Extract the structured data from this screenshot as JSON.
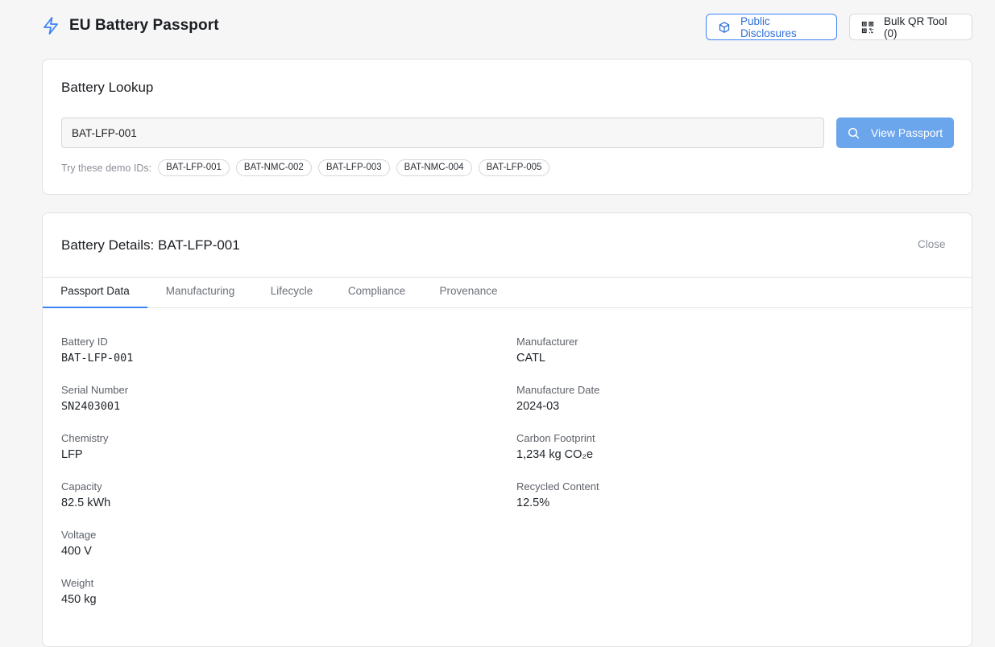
{
  "app": {
    "title": "EU Battery Passport",
    "accent_color": "#3b82f6",
    "icon": "lightning-bolt-icon"
  },
  "header": {
    "public_disclosures_label": "Public Disclosures",
    "public_disclosures_icon": "cube-icon",
    "bulk_qr_label": "Bulk QR Tool (0)",
    "bulk_qr_icon": "qr-code-icon"
  },
  "lookup": {
    "title": "Battery Lookup",
    "input_value": "BAT-LFP-001",
    "view_button_label": "View Passport",
    "view_button_icon": "search-icon",
    "demo_label": "Try these demo IDs:",
    "demo_ids": [
      "BAT-LFP-001",
      "BAT-NMC-002",
      "BAT-LFP-003",
      "BAT-NMC-004",
      "BAT-LFP-005"
    ]
  },
  "details": {
    "title": "Battery Details: BAT-LFP-001",
    "close_label": "Close",
    "tabs": [
      "Passport Data",
      "Manufacturing",
      "Lifecycle",
      "Compliance",
      "Provenance"
    ],
    "active_tab": "Passport Data",
    "left_fields": [
      {
        "label": "Battery ID",
        "value": "BAT-LFP-001"
      },
      {
        "label": "Serial Number",
        "value": "SN2403001"
      },
      {
        "label": "Chemistry",
        "value": "LFP"
      },
      {
        "label": "Capacity",
        "value": "82.5 kWh"
      },
      {
        "label": "Voltage",
        "value": "400 V"
      },
      {
        "label": "Weight",
        "value": "450 kg"
      }
    ],
    "right_fields": [
      {
        "label": "Manufacturer",
        "value": "CATL"
      },
      {
        "label": "Manufacture Date",
        "value": "2024-03"
      },
      {
        "label": "Carbon Footprint",
        "value": "1,234 kg CO₂e"
      },
      {
        "label": "Recycled Content",
        "value": "12.5%"
      }
    ]
  }
}
